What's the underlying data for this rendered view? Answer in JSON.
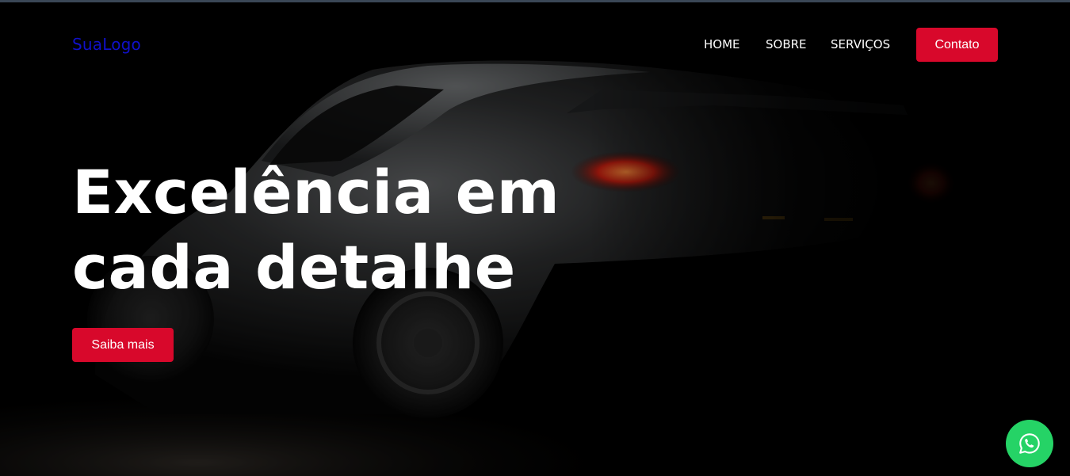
{
  "header": {
    "logo": "SuaLogo",
    "nav": {
      "home": "HOME",
      "sobre": "SOBRE",
      "servicos": "SERVIÇOS"
    },
    "contact_button": "Contato"
  },
  "hero": {
    "title_line1": "Excelência em",
    "title_line2": "cada detalhe",
    "cta_button": "Saiba mais",
    "background": "dark-sports-car-image"
  },
  "floating": {
    "whatsapp_icon": "whatsapp-icon"
  },
  "colors": {
    "accent": "#d8082b",
    "logo": "#1010c8",
    "whatsapp": "#25d366",
    "background": "#000000"
  }
}
